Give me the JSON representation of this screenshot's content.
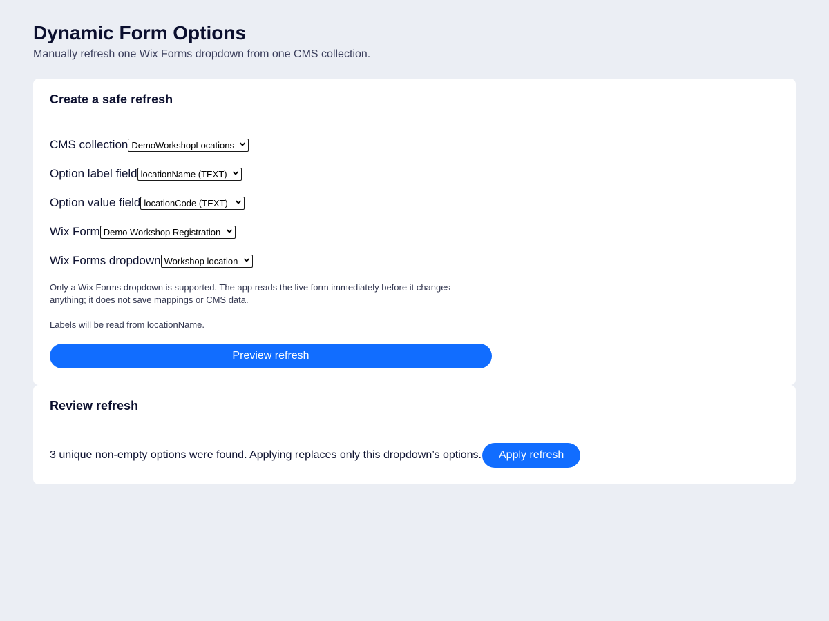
{
  "header": {
    "title": "Dynamic Form Options",
    "subtitle": "Manually refresh one Wix Forms dropdown from one CMS collection."
  },
  "setup_card": {
    "title": "Create a safe refresh",
    "fields": {
      "collection": {
        "label": "CMS collection",
        "value": "DemoWorkshopLocations"
      },
      "label_field": {
        "label": "Option label field",
        "value": "locationName (TEXT)"
      },
      "value_field": {
        "label": "Option value field",
        "value": "locationCode (TEXT)"
      },
      "form": {
        "label": "Wix Form",
        "value": "Demo Workshop Registration"
      },
      "dropdown": {
        "label": "Wix Forms dropdown",
        "value": "Workshop location"
      }
    },
    "help_text": "Only a Wix Forms dropdown is supported. The app reads the live form immediately before it changes anything; it does not save mappings or CMS data.",
    "labels_note": "Labels will be read from locationName.",
    "preview_button": "Preview refresh"
  },
  "review_card": {
    "title": "Review refresh",
    "summary": "3 unique non-empty options were found. Applying replaces only this dropdown’s options.",
    "apply_button": "Apply refresh"
  },
  "colors": {
    "background": "#ebeef4",
    "card": "#ffffff",
    "primary": "#116dff",
    "heading": "#0b0f2e"
  },
  "icons": {
    "select_chevron": "chevron-down-icon"
  }
}
